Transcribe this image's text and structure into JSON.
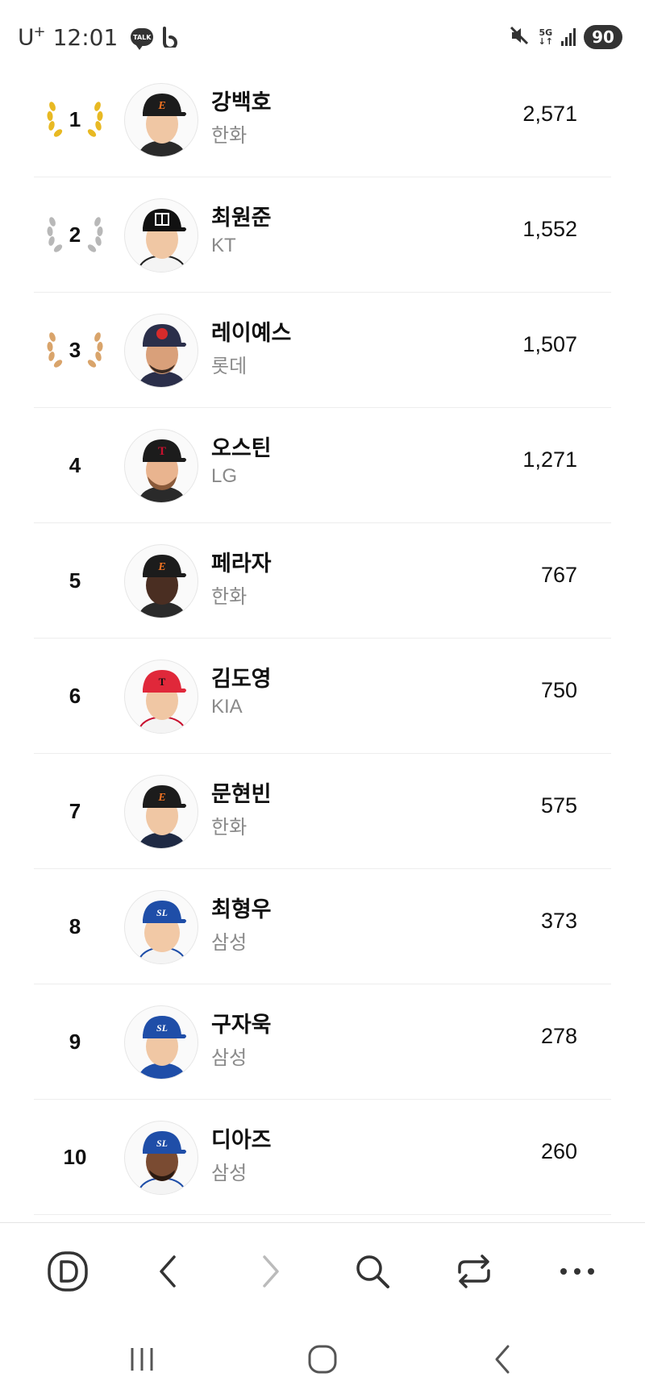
{
  "status_bar": {
    "carrier": "U",
    "carrier_plus": "+",
    "time": "12:01",
    "talk_label": "TALK",
    "network": "5G",
    "battery": "90",
    "icons": [
      "talk-icon",
      "band-icon",
      "mute-icon",
      "signal-icon",
      "battery-icon"
    ]
  },
  "rankings": [
    {
      "rank": "1",
      "name": "강백호",
      "team": "한화",
      "score": "2,571",
      "medal": "gold"
    },
    {
      "rank": "2",
      "name": "최원준",
      "team": "KT",
      "score": "1,552",
      "medal": "silver"
    },
    {
      "rank": "3",
      "name": "레이예스",
      "team": "롯데",
      "score": "1,507",
      "medal": "bronze"
    },
    {
      "rank": "4",
      "name": "오스틴",
      "team": "LG",
      "score": "1,271",
      "medal": "none"
    },
    {
      "rank": "5",
      "name": "페라자",
      "team": "한화",
      "score": "767",
      "medal": "none"
    },
    {
      "rank": "6",
      "name": "김도영",
      "team": "KIA",
      "score": "750",
      "medal": "none"
    },
    {
      "rank": "7",
      "name": "문현빈",
      "team": "한화",
      "score": "575",
      "medal": "none"
    },
    {
      "rank": "8",
      "name": "최형우",
      "team": "삼성",
      "score": "373",
      "medal": "none"
    },
    {
      "rank": "9",
      "name": "구자욱",
      "team": "삼성",
      "score": "278",
      "medal": "none"
    },
    {
      "rank": "10",
      "name": "디아즈",
      "team": "삼성",
      "score": "260",
      "medal": "none"
    }
  ],
  "colors": {
    "gold": "#e8b923",
    "silver": "#b8b8b8",
    "bronze": "#d9a46b",
    "hanwha_cap": "#1c1c1c",
    "hanwha_logo": "#f37321",
    "kt_cap": "#111111",
    "lotte_cap": "#2b2f4a",
    "lotte_logo": "#d62b2b",
    "lg_cap": "#1c1c1c",
    "lg_logo": "#c8102e",
    "kia_cap": "#e0283a",
    "samsung_cap": "#1f4ea8",
    "divider": "#ededed"
  },
  "toolbar": {
    "buttons": [
      "home-d-icon",
      "back-icon",
      "forward-icon",
      "search-icon",
      "tabs-switch-icon",
      "more-icon"
    ]
  },
  "system_nav": {
    "buttons": [
      "recent-apps-icon",
      "home-icon",
      "back-icon"
    ]
  }
}
